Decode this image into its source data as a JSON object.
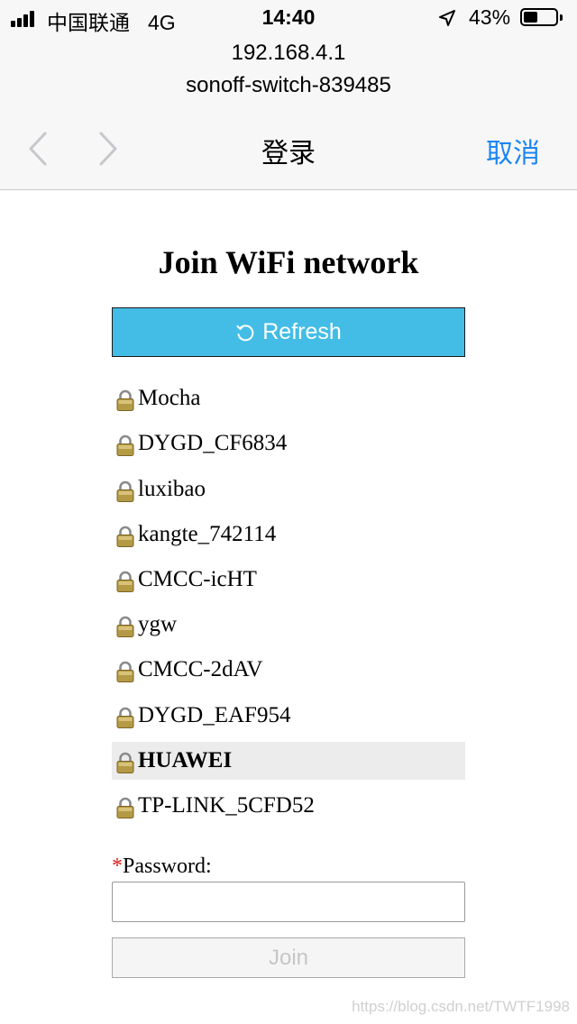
{
  "status_bar": {
    "carrier": "中国联通",
    "network": "4G",
    "time": "14:40",
    "battery": "43%",
    "battery_level": 0.43
  },
  "header": {
    "host": "192.168.4.1",
    "subtitle": "sonoff-switch-839485",
    "nav_title": "登录",
    "cancel_label": "取消"
  },
  "page": {
    "heading": "Join WiFi network",
    "refresh_label": "Refresh",
    "networks": [
      {
        "ssid": "Mocha"
      },
      {
        "ssid": "DYGD_CF6834"
      },
      {
        "ssid": "luxibao"
      },
      {
        "ssid": "kangte_742114"
      },
      {
        "ssid": "CMCC-icHT"
      },
      {
        "ssid": "ygw"
      },
      {
        "ssid": "CMCC-2dAV"
      },
      {
        "ssid": "DYGD_EAF954"
      },
      {
        "ssid": "HUAWEI",
        "selected": true
      },
      {
        "ssid": "TP-LINK_5CFD52"
      }
    ],
    "required_mark": "*",
    "password_label": "Password:",
    "password_value": "",
    "join_label": "Join"
  },
  "watermark": "https://blog.csdn.net/TWTF1998",
  "colors": {
    "accent": "#1b86f5",
    "refresh_bg": "#43bde6",
    "selected_row": "#ececec",
    "required": "#e01b1b"
  }
}
